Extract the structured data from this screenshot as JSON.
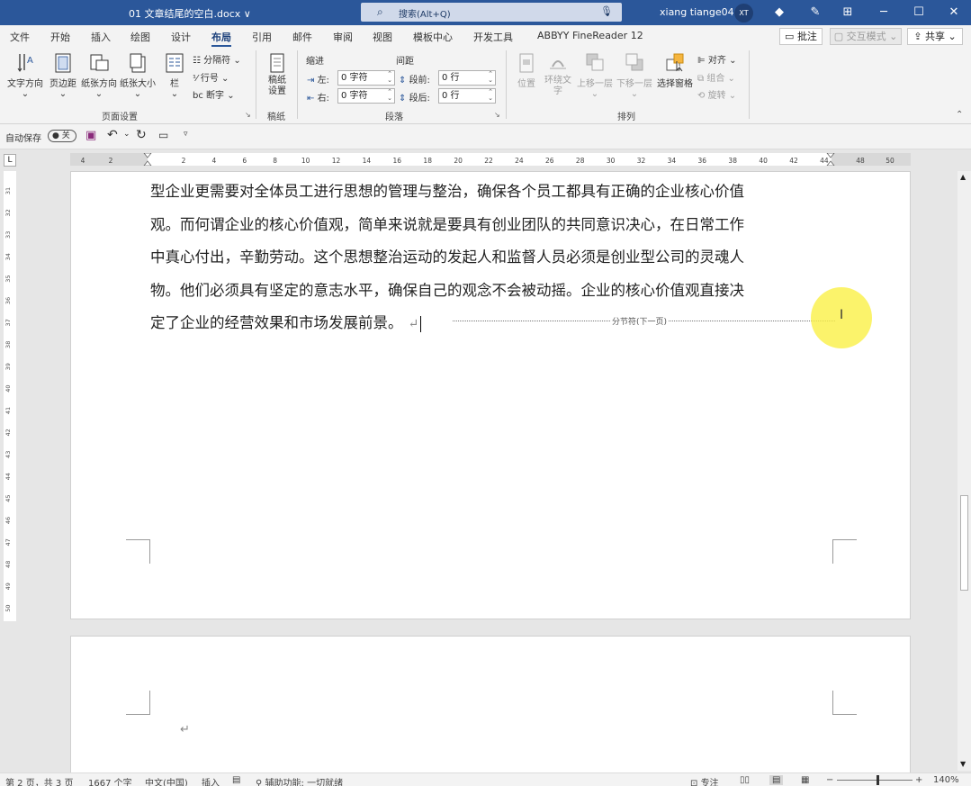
{
  "titlebar": {
    "doc_title": "01 文章结尾的空白.docx ∨",
    "search_placeholder": "搜索(Alt+Q)",
    "user_name": "xiang tiange04",
    "avatar_initials": "XT"
  },
  "tabs": [
    "文件",
    "开始",
    "插入",
    "绘图",
    "设计",
    "布局",
    "引用",
    "邮件",
    "审阅",
    "视图",
    "模板中心",
    "开发工具",
    "ABBYY FineReader 12"
  ],
  "active_tab": "布局",
  "top_right": {
    "comment": "批注",
    "mode": "交互模式",
    "share": "共享"
  },
  "ribbon": {
    "page_setup": {
      "text_direction": "文字方向",
      "margins": "页边距",
      "orientation": "纸张方向",
      "size": "纸张大小",
      "columns": "栏",
      "breaks": "分隔符",
      "line_numbers": "行号",
      "hyphenation": "断字",
      "label": "页面设置"
    },
    "manuscript": {
      "settings": "稿纸设置",
      "label": "稿纸"
    },
    "paragraph": {
      "indent_title": "缩进",
      "spacing_title": "间距",
      "left_label": "左:",
      "left_value": "0 字符",
      "right_label": "右:",
      "right_value": "0 字符",
      "before_label": "段前:",
      "before_value": "0 行",
      "after_label": "段后:",
      "after_value": "0 行",
      "label": "段落"
    },
    "arrange": {
      "position": "位置",
      "wrap_text": "环绕文字",
      "bring_forward": "上移一层",
      "send_backward": "下移一层",
      "selection_pane": "选择窗格",
      "align": "对齐",
      "group": "组合",
      "rotate": "旋转",
      "label": "排列"
    }
  },
  "qat": {
    "autosave_label": "自动保存",
    "autosave_state": "关"
  },
  "ruler_numbers": [
    "4",
    "2",
    "2",
    "4",
    "6",
    "8",
    "10",
    "12",
    "14",
    "16",
    "18",
    "20",
    "22",
    "24",
    "26",
    "28",
    "30",
    "32",
    "34",
    "36",
    "38",
    "40",
    "42",
    "44",
    "48",
    "50"
  ],
  "vruler_numbers": [
    "31",
    "32",
    "33",
    "34",
    "35",
    "36",
    "37",
    "38",
    "39",
    "40",
    "41",
    "42",
    "43",
    "44",
    "45",
    "46",
    "47",
    "48",
    "49",
    "50"
  ],
  "document": {
    "lines": [
      "型企业更需要对全体员工进行思想的管理与整治，确保各个员工都具有正确的企业核心价值",
      "观。而何谓企业的核心价值观，简单来说就是要具有创业团队的共同意识决心，在日常工作",
      "中真心付出，辛勤劳动。这个思想整治运动的发起人和监督人员必须是创业型公司的灵魂人",
      "物。他们必须具有坚定的意志水平，确保自己的观念不会被动摇。企业的核心价值观直接决",
      "定了企业的经营效果和市场发展前景。"
    ],
    "paragraph_mark": "↵",
    "section_break": "分节符(下一页)",
    "page2_mark": "↵"
  },
  "statusbar": {
    "page": "第 2 页，共 3 页",
    "words": "1667 个字",
    "language": "中文(中国)",
    "insert_mode": "插入",
    "accessibility": "辅助功能: 一切就绪",
    "focus": "专注",
    "zoom": "140%"
  }
}
